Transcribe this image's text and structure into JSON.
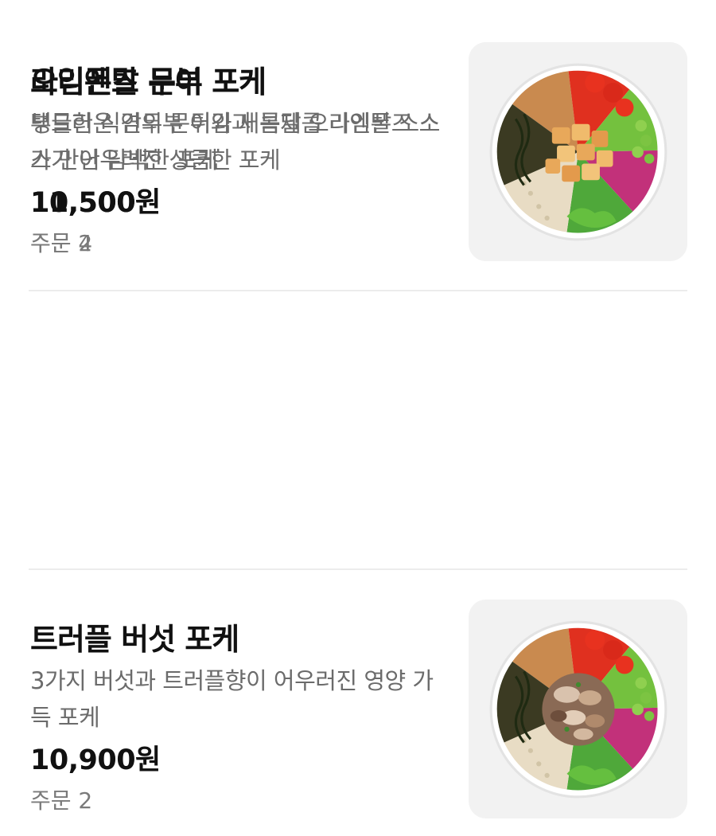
{
  "menu": {
    "items": [
      {
        "name": "라임폰즈 문어 포케",
        "description": "탱글한 식감의 문어와 새콤달콤 라임폰즈 소스가 어우러진 상큼한 포케",
        "price": "11,500원",
        "orders": "주문 2",
        "image_icon": "octopus-poke-bowl"
      },
      {
        "name": "트러플 버섯 포케",
        "description": "3가지 버섯과 트러플향이 어우러진 영양 가득 포케",
        "price": "10,900원",
        "orders": "주문 2",
        "image_icon": "truffle-mushroom-poke-bowl"
      },
      {
        "name": "오리엔탈 두부 포케",
        "description": "부드러운 연두부 튀김과 특제 오리엔탈 소스가 만난 담백한 포케",
        "price": "10,500원",
        "orders": "주문 4",
        "image_icon": "oriental-tofu-poke-bowl"
      }
    ]
  },
  "colors": {
    "text_primary": "#111111",
    "text_secondary": "#6b6b6b",
    "thumb_bg": "#f2f2f2",
    "divider": "#ececec"
  }
}
